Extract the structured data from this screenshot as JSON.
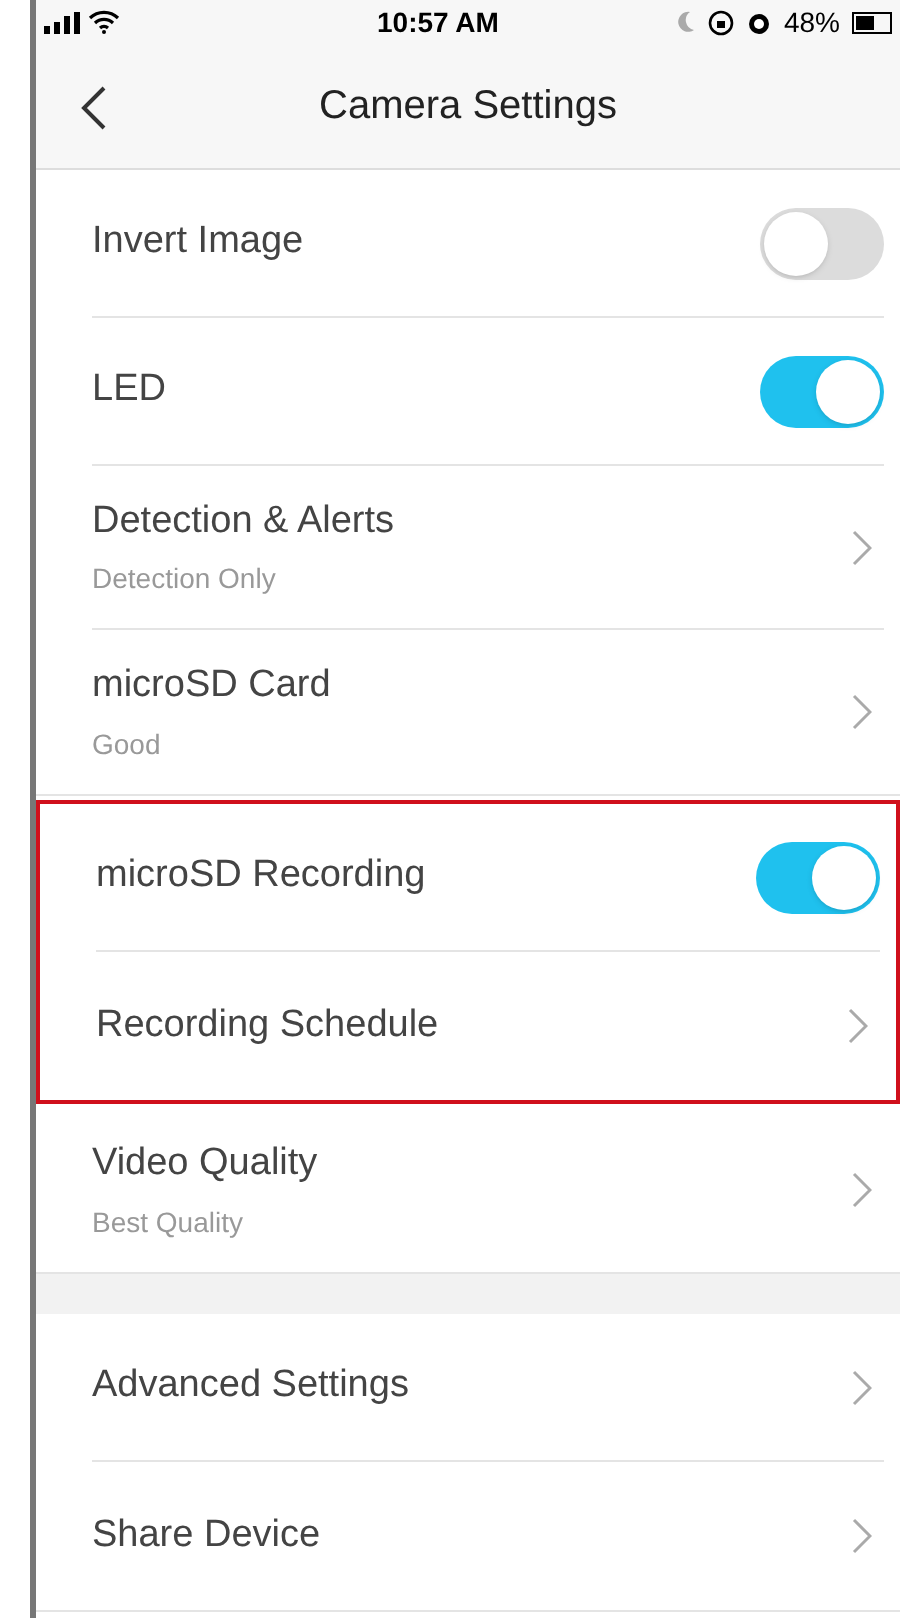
{
  "status_bar": {
    "time": "10:57 AM",
    "battery": "48%"
  },
  "nav": {
    "title": "Camera Settings"
  },
  "groups": [
    {
      "rows": [
        {
          "kind": "toggle",
          "label": "Invert Image",
          "on": false
        },
        {
          "kind": "toggle",
          "label": "LED",
          "on": true
        },
        {
          "kind": "link",
          "label": "Detection & Alerts",
          "subtitle": "Detection Only"
        },
        {
          "kind": "link",
          "label": "microSD Card",
          "subtitle": "Good"
        }
      ]
    },
    {
      "highlighted": true,
      "rows": [
        {
          "kind": "toggle",
          "label": "microSD Recording",
          "on": true
        },
        {
          "kind": "link",
          "label": "Recording Schedule"
        }
      ]
    },
    {
      "rows": [
        {
          "kind": "link",
          "label": "Video Quality",
          "subtitle": "Best Quality"
        }
      ]
    },
    {
      "gap_before": true,
      "rows": [
        {
          "kind": "link",
          "label": "Advanced Settings"
        },
        {
          "kind": "link",
          "label": "Share Device"
        }
      ]
    }
  ]
}
